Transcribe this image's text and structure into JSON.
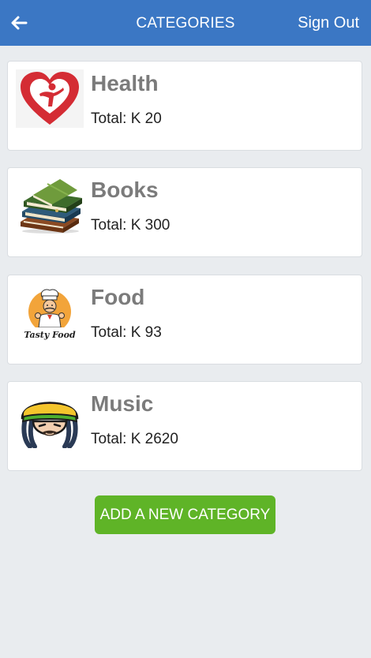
{
  "header": {
    "title": "CATEGORIES",
    "back_icon": "arrow-left-icon",
    "sign_out_label": "Sign Out",
    "bar_color": "#3b77c4"
  },
  "categories": [
    {
      "name": "Health",
      "total_label": "Total: K 20",
      "icon": "health-heart-logo"
    },
    {
      "name": "Books",
      "total_label": "Total: K 300",
      "icon": "books-stack-image"
    },
    {
      "name": "Food",
      "total_label": "Total: K 93",
      "icon": "tasty-food-chef-logo",
      "logo_text": "Tasty Food"
    },
    {
      "name": "Music",
      "total_label": "Total: K 2620",
      "icon": "rasta-face-avatar"
    }
  ],
  "actions": {
    "add_category_label": "ADD A NEW CATEGORY",
    "add_button_color": "#5fb427"
  }
}
